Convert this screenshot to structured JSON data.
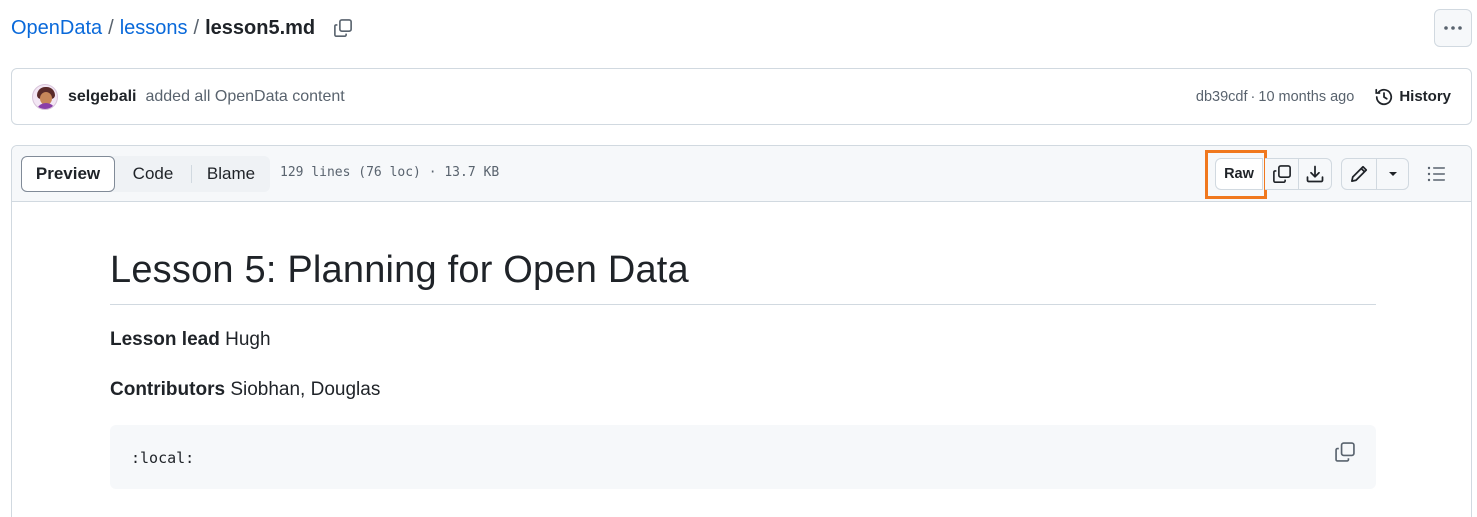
{
  "breadcrumb": {
    "repo": "OpenData",
    "folder": "lessons",
    "file": "lesson5.md",
    "separator": "/"
  },
  "commit": {
    "author": "selgebali",
    "message": "added all OpenData content",
    "hash": "db39cdf",
    "age": "10 months ago",
    "dot": "·",
    "history_label": "History"
  },
  "file_header": {
    "tabs": [
      "Preview",
      "Code",
      "Blame"
    ],
    "active_tab": "Preview",
    "info": "129 lines (76 loc) · 13.7 KB",
    "raw_label": "Raw",
    "highlight_color": "#f0781e"
  },
  "content": {
    "title": "Lesson 5: Planning for Open Data",
    "lesson_lead_label": "Lesson lead",
    "lesson_lead_value": "Hugh",
    "contributors_label": "Contributors",
    "contributors_value": "Siobhan, Douglas",
    "code": ":local:"
  },
  "colors": {
    "link": "#0969da",
    "muted": "#59636e",
    "border": "#d1d9e0",
    "header_bg": "#f6f8fa"
  }
}
